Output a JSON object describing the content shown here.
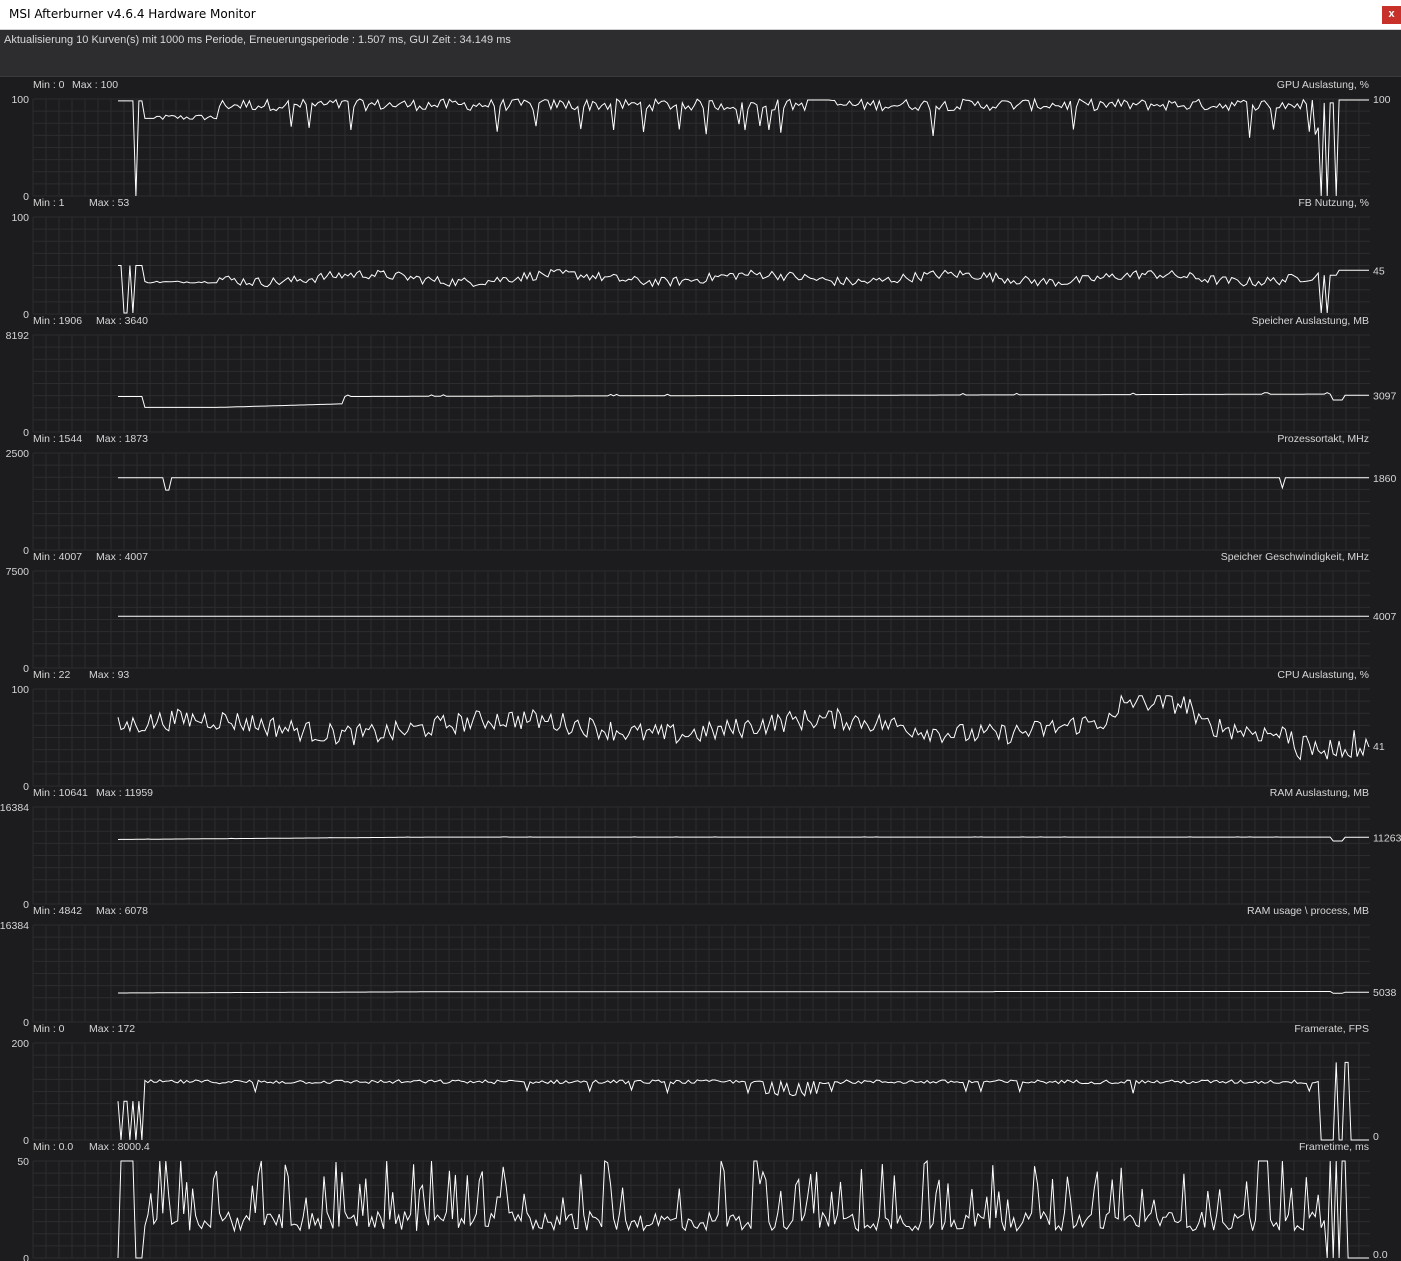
{
  "window": {
    "title": "MSI Afterburner v4.6.4 Hardware Monitor",
    "close_label": "x"
  },
  "status": {
    "text": "Aktualisierung 10 Kurven(s) mit 1000 ms Periode, Erneuerungsperiode : 1.507 ms, GUI Zeit : 34.149 ms"
  },
  "chart_data": [
    {
      "type": "line",
      "title": "GPU Auslastung, %",
      "min_label": "Min : 0",
      "max_label": "Max : 100",
      "ylim": [
        0,
        100
      ],
      "y_top_label": "100",
      "y_bottom_label": "0",
      "current": "100",
      "profile": "gpu"
    },
    {
      "type": "line",
      "title": "FB Nutzung, %",
      "min_label": "Min : 1",
      "max_label": "Max : 53",
      "ylim": [
        0,
        100
      ],
      "y_top_label": "100",
      "y_bottom_label": "0",
      "current": "45",
      "profile": "fb"
    },
    {
      "type": "line",
      "title": "Speicher Auslastung, MB",
      "min_label": "Min : 1906",
      "max_label": "Max : 3640",
      "ylim": [
        0,
        8192
      ],
      "y_top_label": "8192",
      "y_bottom_label": "0",
      "current": "3097",
      "profile": "vram"
    },
    {
      "type": "line",
      "title": "Prozessortakt, MHz",
      "min_label": "Min : 1544",
      "max_label": "Max : 1873",
      "ylim": [
        0,
        2500
      ],
      "y_top_label": "2500",
      "y_bottom_label": "0",
      "current": "1860",
      "profile": "clock"
    },
    {
      "type": "line",
      "title": "Speicher Geschwindigkeit, MHz",
      "min_label": "Min : 4007",
      "max_label": "Max : 4007",
      "ylim": [
        0,
        7500
      ],
      "y_top_label": "7500",
      "y_bottom_label": "0",
      "current": "4007",
      "profile": "flat"
    },
    {
      "type": "line",
      "title": "CPU Auslastung, %",
      "min_label": "Min : 22",
      "max_label": "Max : 93",
      "ylim": [
        0,
        100
      ],
      "y_top_label": "100",
      "y_bottom_label": "0",
      "current": "41",
      "profile": "cpu"
    },
    {
      "type": "line",
      "title": "RAM Auslastung, MB",
      "min_label": "Min : 10641",
      "max_label": "Max : 11959",
      "ylim": [
        0,
        16384
      ],
      "y_top_label": "16384",
      "y_bottom_label": "0",
      "current": "11263",
      "profile": "ram"
    },
    {
      "type": "line",
      "title": "RAM usage \\ process, MB",
      "min_label": "Min : 4842",
      "max_label": "Max : 6078",
      "ylim": [
        0,
        16384
      ],
      "y_top_label": "16384",
      "y_bottom_label": "0",
      "current": "5038",
      "profile": "ramproc"
    },
    {
      "type": "line",
      "title": "Framerate, FPS",
      "min_label": "Min : 0",
      "max_label": "Max : 172",
      "ylim": [
        0,
        200
      ],
      "y_top_label": "200",
      "y_bottom_label": "0",
      "current": "0",
      "profile": "fps"
    },
    {
      "type": "line",
      "title": "Frametime, ms",
      "min_label": "Min : 0.0",
      "max_label": "Max : 8000.4",
      "ylim": [
        0,
        50
      ],
      "y_top_label": "50",
      "y_bottom_label": "0",
      "current": "0.0",
      "profile": "frametime"
    }
  ]
}
